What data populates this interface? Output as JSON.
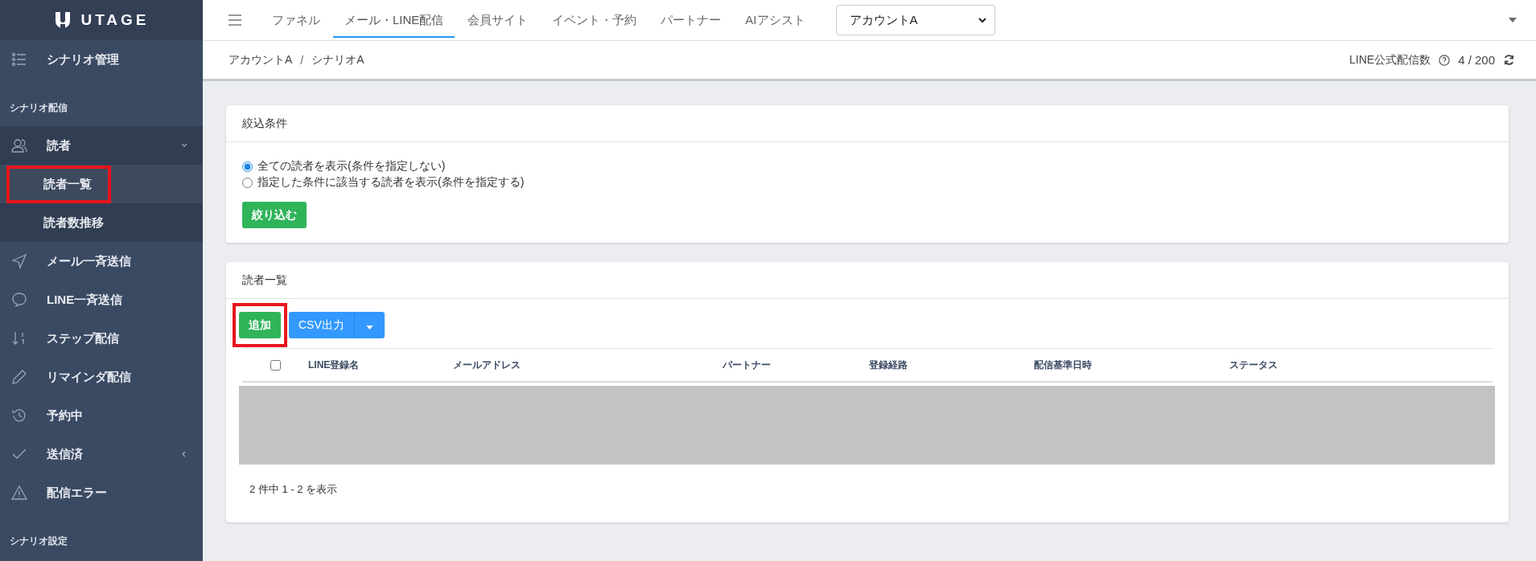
{
  "sidebar": {
    "logo": "UTAGE",
    "items": [
      {
        "kind": "item",
        "label": "シナリオ管理"
      },
      {
        "kind": "section",
        "label": "シナリオ配信"
      },
      {
        "kind": "group",
        "label": "読者",
        "expanded": true,
        "children": [
          {
            "label": "読者一覧",
            "selected": true,
            "highlighted": true
          },
          {
            "label": "読者数推移",
            "selected": false,
            "highlighted": false
          }
        ]
      },
      {
        "kind": "item",
        "label": "メール一斉送信"
      },
      {
        "kind": "item",
        "label": "LINE一斉送信"
      },
      {
        "kind": "item",
        "label": "ステップ配信"
      },
      {
        "kind": "item",
        "label": "リマインダ配信"
      },
      {
        "kind": "item",
        "label": "予約中"
      },
      {
        "kind": "group",
        "label": "送信済",
        "expanded": false
      },
      {
        "kind": "item",
        "label": "配信エラー"
      },
      {
        "kind": "section",
        "label": "シナリオ設定"
      }
    ]
  },
  "top_nav": {
    "items": [
      {
        "label": "ファネル",
        "selected": false
      },
      {
        "label": "メール・LINE配信",
        "selected": true
      },
      {
        "label": "会員サイト",
        "selected": false
      },
      {
        "label": "イベント・予約",
        "selected": false
      },
      {
        "label": "パートナー",
        "selected": false
      },
      {
        "label": "AIアシスト",
        "selected": false
      }
    ],
    "account_select": "アカウントA"
  },
  "breadcrumb": {
    "items": [
      "アカウントA",
      "シナリオA"
    ],
    "separator": "/"
  },
  "line_quota": {
    "label": "LINE公式配信数",
    "value": "4 / 200"
  },
  "filter_card": {
    "title": "絞込条件",
    "options": [
      {
        "label": "全ての読者を表示(条件を指定しない)",
        "selected": true
      },
      {
        "label": "指定した条件に該当する読者を表示(条件を指定する)",
        "selected": false
      }
    ],
    "button": "絞り込む"
  },
  "readers_card": {
    "title": "読者一覧",
    "add_button": {
      "label": "追加",
      "highlighted": true
    },
    "csv_button": "CSV出力",
    "table": {
      "select_all": false,
      "columns": [
        "LINE登録名",
        "メールアドレス",
        "パートナー",
        "登録経路",
        "配信基準日時",
        "ステータス"
      ]
    },
    "summary": "2 件中 1 - 2 を表示"
  }
}
